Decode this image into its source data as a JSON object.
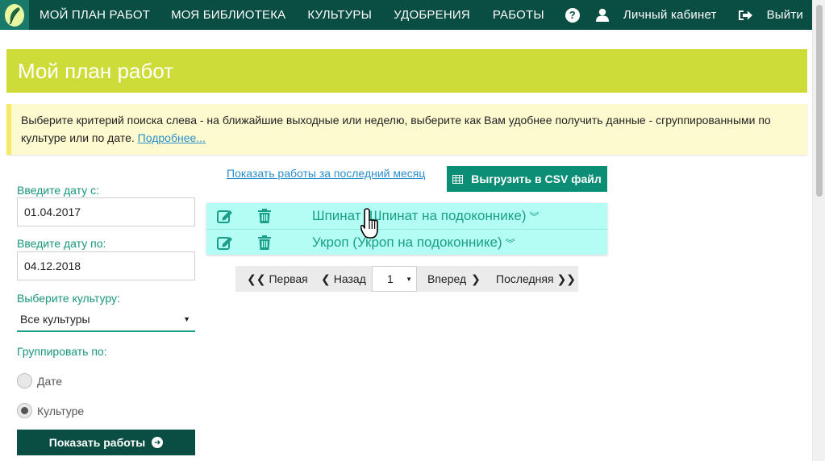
{
  "nav": {
    "items": [
      "МОЙ ПЛАН РАБОТ",
      "МОЯ БИБЛИОТЕКА",
      "КУЛЬТУРЫ",
      "УДОБРЕНИЯ",
      "РАБОТЫ"
    ],
    "help_label": "?",
    "cabinet_label": "Личный кабинет",
    "logout_label": "Выйти"
  },
  "page": {
    "title": "Мой план работ",
    "info_text": "Выберите критерий поиска слева - на ближайшие выходные или неделю, выберите как Вам удобнее получить данные - сгруппированными по культуре или по дате.",
    "info_link": "Подробнее..."
  },
  "form": {
    "date_from_label": "Введите дату с:",
    "date_from_value": "01.04.2017",
    "date_to_label": "Введите дату по:",
    "date_to_value": "04.12.2018",
    "culture_label": "Выберите культуру:",
    "culture_value": "Все культуры",
    "group_label": "Группировать по:",
    "group_options": [
      "Дате",
      "Культуре"
    ],
    "group_selected": "Культуре",
    "show_button": "Показать работы"
  },
  "results": {
    "month_link": "Показать работы за последний месяц",
    "csv_button": "Выгрузить в CSV файл",
    "rows": [
      {
        "title": "Шпинат (Шпинат на подоконнике)"
      },
      {
        "title": "Укроп (Укроп на подоконнике)"
      }
    ],
    "pager": {
      "first": "Первая",
      "prev": "Назад",
      "page": "1",
      "next": "Вперед",
      "last": "Последняя"
    }
  },
  "colors": {
    "nav_bg": "#0a4d43",
    "header_bg": "#cddc39",
    "accent": "#1a9f86",
    "csv_button_bg": "#0c8d76",
    "list_bg": "#b4fdf5",
    "info_bg": "#fefad0"
  },
  "icons": [
    "logo-icon",
    "help-icon",
    "user-icon",
    "logout-icon",
    "table-icon",
    "edit-icon",
    "trash-icon",
    "arrow-circle-right-icon",
    "hand-cursor-icon"
  ]
}
